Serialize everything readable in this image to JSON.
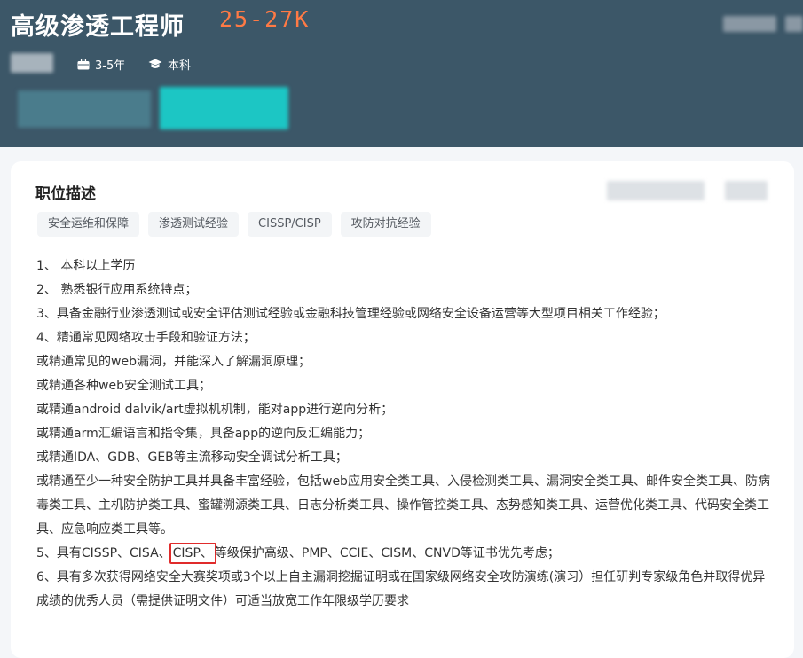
{
  "header": {
    "title": "高级渗透工程师",
    "salary": "25-27K",
    "experience": "3-5年",
    "education": "本科"
  },
  "description": {
    "heading": "职位描述",
    "tags": [
      "安全运维和保障",
      "渗透测试经验",
      "CISSP/CISP",
      "攻防对抗经验"
    ],
    "lines": [
      "1、 本科以上学历",
      "2、 熟悉银行应用系统特点；",
      "3、具备金融行业渗透测试或安全评估测试经验或金融科技管理经验或网络安全设备运营等大型项目相关工作经验；",
      "4、精通常见网络攻击手段和验证方法；",
      "或精通常见的web漏洞，并能深入了解漏洞原理；",
      "或精通各种web安全测试工具；",
      "或精通android dalvik/art虚拟机机制，能对app进行逆向分析；",
      "或精通arm汇编语言和指令集，具备app的逆向反汇编能力；",
      "或精通IDA、GDB、GEB等主流移动安全调试分析工具；",
      "或精通至少一种安全防护工具并具备丰富经验，包括web应用安全类工具、入侵检测类工具、漏洞安全类工具、邮件安全类工具、防病毒类工具、主机防护类工具、蜜罐溯源类工具、日志分析类工具、操作管控类工具、态势感知类工具、运营优化类工具、代码安全类工具、应急响应类工具等。"
    ],
    "line5": {
      "before": "5、具有CISSP、CISA、",
      "highlight": "CISP、",
      "after": "等级保护高级、PMP、CCIE、CISM、CNVD等证书优先考虑；"
    },
    "line6": "6、具有多次获得网络安全大赛奖项或3个以上自主漏洞挖掘证明或在国家级网络安全攻防演练(演习）担任研判专家级角色并取得优异成绩的优秀人员（需提供证明文件）可适当放宽工作年限级学历要求"
  },
  "colors": {
    "header_bg": "#3c5768",
    "salary": "#ff7a45",
    "highlight_box": "#e02b2b",
    "tag_bg": "#f3f5f7"
  }
}
